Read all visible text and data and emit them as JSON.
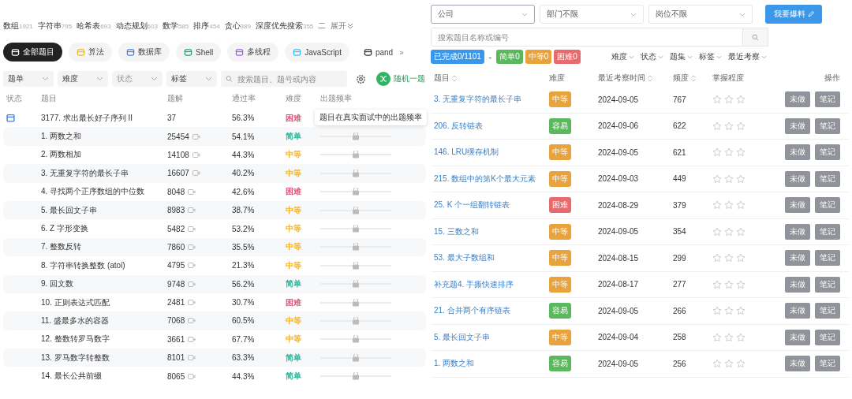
{
  "left": {
    "topic_tags": [
      {
        "label": "数组",
        "count": "1921"
      },
      {
        "label": "字符串",
        "count": "795"
      },
      {
        "label": "哈希表",
        "count": "693"
      },
      {
        "label": "动态规划",
        "count": "603"
      },
      {
        "label": "数学",
        "count": "585"
      },
      {
        "label": "排序",
        "count": "454"
      },
      {
        "label": "贪心",
        "count": "389"
      },
      {
        "label": "深度优先搜索",
        "count": "355"
      },
      {
        "label": "二"
      }
    ],
    "expand": "展开",
    "categories": [
      {
        "label": "全部题目",
        "selected": true
      },
      {
        "label": "算法",
        "selected": false
      },
      {
        "label": "数据库",
        "selected": false
      },
      {
        "label": "Shell",
        "selected": false
      },
      {
        "label": "多线程",
        "selected": false
      },
      {
        "label": "JavaScript",
        "selected": false
      },
      {
        "label": "pand",
        "selected": false
      }
    ],
    "more": "»",
    "filters": [
      {
        "label": "题单",
        "disabled": false
      },
      {
        "label": "难度",
        "disabled": false
      },
      {
        "label": "状态",
        "disabled": true
      },
      {
        "label": "标签",
        "disabled": false
      }
    ],
    "search": {
      "placeholder": "搜索题目、题号或内容"
    },
    "random_button": "随机一题",
    "columns": [
      "状态",
      "题目",
      "题解",
      "通过率",
      "难度",
      "出题频率"
    ],
    "tooltip": "题目在真实面试中的出题频率",
    "rows": [
      {
        "daily": true,
        "title": "3177. 求出最长好子序列 II",
        "solutions": "37",
        "video": false,
        "rate": "56.3%",
        "difficulty": "困难",
        "color": "#e0577a"
      },
      {
        "daily": false,
        "title": "1. 两数之和",
        "solutions": "25454",
        "video": true,
        "rate": "54.1%",
        "difficulty": "简单",
        "color": "#2db59b"
      },
      {
        "daily": false,
        "title": "2. 两数相加",
        "solutions": "14108",
        "video": true,
        "rate": "44.3%",
        "difficulty": "中等",
        "color": "#f0b429"
      },
      {
        "daily": false,
        "title": "3. 无重复字符的最长子串",
        "solutions": "16607",
        "video": true,
        "rate": "40.2%",
        "difficulty": "中等",
        "color": "#f0b429"
      },
      {
        "daily": false,
        "title": "4. 寻找两个正序数组的中位数",
        "solutions": "8048",
        "video": true,
        "rate": "42.6%",
        "difficulty": "困难",
        "color": "#e0577a"
      },
      {
        "daily": false,
        "title": "5. 最长回文子串",
        "solutions": "8983",
        "video": true,
        "rate": "38.7%",
        "difficulty": "中等",
        "color": "#f0b429"
      },
      {
        "daily": false,
        "title": "6. Z 字形变换",
        "solutions": "5482",
        "video": true,
        "rate": "53.2%",
        "difficulty": "中等",
        "color": "#f0b429"
      },
      {
        "daily": false,
        "title": "7. 整数反转",
        "solutions": "7860",
        "video": true,
        "rate": "35.5%",
        "difficulty": "中等",
        "color": "#f0b429"
      },
      {
        "daily": false,
        "title": "8. 字符串转换整数 (atoi)",
        "solutions": "4795",
        "video": true,
        "rate": "21.3%",
        "difficulty": "中等",
        "color": "#f0b429"
      },
      {
        "daily": false,
        "title": "9. 回文数",
        "solutions": "9748",
        "video": true,
        "rate": "56.2%",
        "difficulty": "简单",
        "color": "#2db59b"
      },
      {
        "daily": false,
        "title": "10. 正则表达式匹配",
        "solutions": "2481",
        "video": true,
        "rate": "30.7%",
        "difficulty": "困难",
        "color": "#e0577a"
      },
      {
        "daily": false,
        "title": "11. 盛最多水的容器",
        "solutions": "7068",
        "video": true,
        "rate": "60.5%",
        "difficulty": "中等",
        "color": "#f0b429"
      },
      {
        "daily": false,
        "title": "12. 整数转罗马数字",
        "solutions": "3661",
        "video": true,
        "rate": "67.7%",
        "difficulty": "中等",
        "color": "#f0b429"
      },
      {
        "daily": false,
        "title": "13. 罗马数字转整数",
        "solutions": "8101",
        "video": true,
        "rate": "63.3%",
        "difficulty": "简单",
        "color": "#2db59b"
      },
      {
        "daily": false,
        "title": "14. 最长公共前缀",
        "solutions": "8065",
        "video": true,
        "rate": "44.3%",
        "difficulty": "简单",
        "color": "#2db59b"
      }
    ]
  },
  "right": {
    "selects": [
      {
        "value": "公司",
        "focused": true
      },
      {
        "value": "部门不限",
        "focused": false
      },
      {
        "value": "岗位不限",
        "focused": false
      }
    ],
    "report_button": "我要爆料",
    "search": {
      "placeholder": "搜索题目名称或编号"
    },
    "progress": {
      "done": "已完成0/1101",
      "sep": "-",
      "counts": [
        {
          "label": "简单0",
          "color": "#5cb85c"
        },
        {
          "label": "中等0",
          "color": "#e8a33d"
        },
        {
          "label": "困难0",
          "color": "#e56b6f"
        }
      ]
    },
    "filters": [
      "难度",
      "状态",
      "题集",
      "标签",
      "最近考察"
    ],
    "columns": [
      {
        "label": "题目",
        "sortable": true
      },
      {
        "label": "难度",
        "sortable": false
      },
      {
        "label": "最近考察时间",
        "sortable": true
      },
      {
        "label": "频度",
        "sortable": true
      },
      {
        "label": "掌握程度",
        "sortable": false
      },
      {
        "label": "操作",
        "sortable": false
      }
    ],
    "rows": [
      {
        "title": "3. 无重复字符的最长子串",
        "difficulty": "中等",
        "color": "#e8a33d",
        "date": "2024-09-05",
        "freq": "767",
        "stars": 0,
        "status": "未做",
        "note": "笔记"
      },
      {
        "title": "206. 反转链表",
        "difficulty": "容易",
        "color": "#5cb85c",
        "date": "2024-09-06",
        "freq": "622",
        "stars": 0,
        "status": "未做",
        "note": "笔记"
      },
      {
        "title": "146. LRU缓存机制",
        "difficulty": "中等",
        "color": "#e8a33d",
        "date": "2024-09-05",
        "freq": "621",
        "stars": 0,
        "status": "未做",
        "note": "笔记"
      },
      {
        "title": "215. 数组中的第K个最大元素",
        "difficulty": "中等",
        "color": "#e8a33d",
        "date": "2024-09-03",
        "freq": "449",
        "stars": 0,
        "status": "未做",
        "note": "笔记"
      },
      {
        "title": "25. K 个一组翻转链表",
        "difficulty": "困难",
        "color": "#e56b6f",
        "date": "2024-08-29",
        "freq": "379",
        "stars": 0,
        "status": "未做",
        "note": "笔记"
      },
      {
        "title": "15. 三数之和",
        "difficulty": "中等",
        "color": "#e8a33d",
        "date": "2024-09-05",
        "freq": "354",
        "stars": 0,
        "status": "未做",
        "note": "笔记"
      },
      {
        "title": "53. 最大子数组和",
        "difficulty": "中等",
        "color": "#e8a33d",
        "date": "2024-08-15",
        "freq": "299",
        "stars": 0,
        "status": "未做",
        "note": "笔记"
      },
      {
        "title": "补充题4. 手撕快速排序",
        "difficulty": "中等",
        "color": "#e8a33d",
        "date": "2024-08-17",
        "freq": "277",
        "stars": 0,
        "status": "未做",
        "note": "笔记"
      },
      {
        "title": "21. 合并两个有序链表",
        "difficulty": "容易",
        "color": "#5cb85c",
        "date": "2024-09-05",
        "freq": "266",
        "stars": 0,
        "status": "未做",
        "note": "笔记"
      },
      {
        "title": "5. 最长回文子串",
        "difficulty": "中等",
        "color": "#e8a33d",
        "date": "2024-09-04",
        "freq": "258",
        "stars": 0,
        "status": "未做",
        "note": "笔记"
      },
      {
        "title": "1. 两数之和",
        "difficulty": "容易",
        "color": "#5cb85c",
        "date": "2024-09-05",
        "freq": "256",
        "stars": 0,
        "status": "未做",
        "note": "笔记"
      }
    ]
  }
}
